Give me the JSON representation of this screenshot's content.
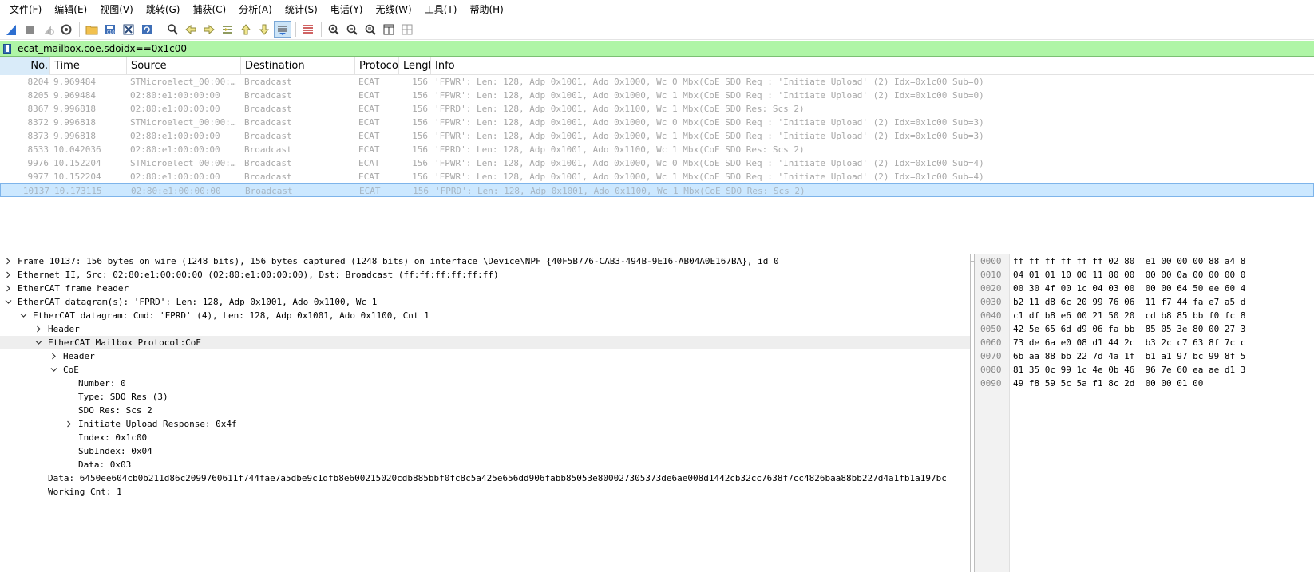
{
  "menu": [
    "文件(F)",
    "编辑(E)",
    "视图(V)",
    "跳转(G)",
    "捕获(C)",
    "分析(A)",
    "统计(S)",
    "电话(Y)",
    "无线(W)",
    "工具(T)",
    "帮助(H)"
  ],
  "toolbar": {
    "icons": [
      "shark-fin-start-icon",
      "stop-square-icon",
      "restart-icon",
      "capture-options-gear-icon",
      "open-folder-icon",
      "save-file-icon",
      "close-file-icon",
      "reload-icon",
      "find-magnifier-icon",
      "go-back-arrow-icon",
      "go-forward-arrow-icon",
      "go-to-packet-icon",
      "go-first-packet-icon",
      "go-last-packet-icon",
      "auto-scroll-icon",
      "colorize-lines-icon",
      "zoom-in-icon",
      "zoom-out-icon",
      "zoom-reset-icon",
      "resize-columns-icon",
      "layout-grid-icon"
    ]
  },
  "filter": {
    "value": "ecat_mailbox.coe.sdoidx==0x1c00"
  },
  "packet_list": {
    "columns": [
      "No.",
      "Time",
      "Source",
      "Destination",
      "Protoco",
      "Lengt",
      "Info"
    ],
    "rows": [
      {
        "no": "8204",
        "time": "9.969484",
        "src": "STMicroelect_00:00:…",
        "dst": "Broadcast",
        "proto": "ECAT",
        "len": "156",
        "info": "'FPWR': Len: 128, Adp 0x1001, Ado 0x1000, Wc 0  Mbx(CoE SDO Req : 'Initiate Upload' (2) Idx=0x1c00 Sub=0)"
      },
      {
        "no": "8205",
        "time": "9.969484",
        "src": "02:80:e1:00:00:00",
        "dst": "Broadcast",
        "proto": "ECAT",
        "len": "156",
        "info": "'FPWR': Len: 128, Adp 0x1001, Ado 0x1000, Wc 1  Mbx(CoE SDO Req : 'Initiate Upload' (2) Idx=0x1c00 Sub=0)"
      },
      {
        "no": "8367",
        "time": "9.996818",
        "src": "02:80:e1:00:00:00",
        "dst": "Broadcast",
        "proto": "ECAT",
        "len": "156",
        "info": "'FPRD': Len: 128, Adp 0x1001, Ado 0x1100, Wc 1  Mbx(CoE SDO Res: Scs 2)"
      },
      {
        "no": "8372",
        "time": "9.996818",
        "src": "STMicroelect_00:00:…",
        "dst": "Broadcast",
        "proto": "ECAT",
        "len": "156",
        "info": "'FPWR': Len: 128, Adp 0x1001, Ado 0x1000, Wc 0  Mbx(CoE SDO Req : 'Initiate Upload' (2) Idx=0x1c00 Sub=3)"
      },
      {
        "no": "8373",
        "time": "9.996818",
        "src": "02:80:e1:00:00:00",
        "dst": "Broadcast",
        "proto": "ECAT",
        "len": "156",
        "info": "'FPWR': Len: 128, Adp 0x1001, Ado 0x1000, Wc 1  Mbx(CoE SDO Req : 'Initiate Upload' (2) Idx=0x1c00 Sub=3)"
      },
      {
        "no": "8533",
        "time": "10.042036",
        "src": "02:80:e1:00:00:00",
        "dst": "Broadcast",
        "proto": "ECAT",
        "len": "156",
        "info": "'FPRD': Len: 128, Adp 0x1001, Ado 0x1100, Wc 1  Mbx(CoE SDO Res: Scs 2)"
      },
      {
        "no": "9976",
        "time": "10.152204",
        "src": "STMicroelect_00:00:…",
        "dst": "Broadcast",
        "proto": "ECAT",
        "len": "156",
        "info": "'FPWR': Len: 128, Adp 0x1001, Ado 0x1000, Wc 0  Mbx(CoE SDO Req : 'Initiate Upload' (2) Idx=0x1c00 Sub=4)"
      },
      {
        "no": "9977",
        "time": "10.152204",
        "src": "02:80:e1:00:00:00",
        "dst": "Broadcast",
        "proto": "ECAT",
        "len": "156",
        "info": "'FPWR': Len: 128, Adp 0x1001, Ado 0x1000, Wc 1  Mbx(CoE SDO Req : 'Initiate Upload' (2) Idx=0x1c00 Sub=4)"
      },
      {
        "no": "10137",
        "time": "10.173115",
        "src": "02:80:e1:00:00:00",
        "dst": "Broadcast",
        "proto": "ECAT",
        "len": "156",
        "info": "'FPRD': Len: 128, Adp 0x1001, Ado 0x1100, Wc 1  Mbx(CoE SDO Res: Scs 2)"
      }
    ]
  },
  "details": [
    {
      "text": "Frame 10137: 156 bytes on wire (1248 bits), 156 bytes captured (1248 bits) on interface \\Device\\NPF_{40F5B776-CAB3-494B-9E16-AB04A0E167BA}, id 0",
      "level": 0,
      "arrow": "right"
    },
    {
      "text": "Ethernet II, Src: 02:80:e1:00:00:00 (02:80:e1:00:00:00), Dst: Broadcast (ff:ff:ff:ff:ff:ff)",
      "level": 0,
      "arrow": "right"
    },
    {
      "text": "EtherCAT frame header",
      "level": 0,
      "arrow": "right"
    },
    {
      "text": "EtherCAT datagram(s): 'FPRD': Len: 128, Adp 0x1001, Ado 0x1100, Wc 1",
      "level": 0,
      "arrow": "down"
    },
    {
      "text": "EtherCAT datagram: Cmd: 'FPRD' (4), Len: 128, Adp 0x1001, Ado 0x1100, Cnt 1",
      "level": 1,
      "arrow": "down"
    },
    {
      "text": "Header",
      "level": 2,
      "arrow": "right"
    },
    {
      "text": "EtherCAT Mailbox Protocol:CoE",
      "level": 2,
      "arrow": "down",
      "highlight": true
    },
    {
      "text": "Header",
      "level": 3,
      "arrow": "right"
    },
    {
      "text": "CoE",
      "level": 3,
      "arrow": "down"
    },
    {
      "text": "Number: 0",
      "level": 4,
      "arrow": "none"
    },
    {
      "text": "Type: SDO Res (3)",
      "level": 4,
      "arrow": "none"
    },
    {
      "text": "SDO Res: Scs 2",
      "level": 4,
      "arrow": "none"
    },
    {
      "text": "Initiate Upload Response: 0x4f",
      "level": 4,
      "arrow": "right"
    },
    {
      "text": "Index: 0x1c00",
      "level": 4,
      "arrow": "none"
    },
    {
      "text": "SubIndex: 0x04",
      "level": 4,
      "arrow": "none"
    },
    {
      "text": "Data: 0x03",
      "level": 4,
      "arrow": "none"
    },
    {
      "text": "Data: 6450ee604cb0b211d86c2099760611f744fae7a5dbe9c1dfb8e600215020cdb885bbf0fc8c5a425e656dd906fabb85053e800027305373de6ae008d1442cb32cc7638f7cc4826baa88bb227d4a1fb1a197bc",
      "level": 2,
      "arrow": "none"
    },
    {
      "text": "Working Cnt: 1",
      "level": 2,
      "arrow": "none"
    }
  ],
  "hex": {
    "offsets": [
      "0000",
      "0010",
      "0020",
      "0030",
      "0040",
      "0050",
      "0060",
      "0070",
      "0080",
      "0090"
    ],
    "bytes": [
      "ff ff ff ff ff ff 02 80  e1 00 00 00 88 a4 8",
      "04 01 01 10 00 11 80 00  00 00 0a 00 00 00 0",
      "00 30 4f 00 1c 04 03 00  00 00 64 50 ee 60 4",
      "b2 11 d8 6c 20 99 76 06  11 f7 44 fa e7 a5 d",
      "c1 df b8 e6 00 21 50 20  cd b8 85 bb f0 fc 8",
      "42 5e 65 6d d9 06 fa bb  85 05 3e 80 00 27 3",
      "73 de 6a e0 08 d1 44 2c  b3 2c c7 63 8f 7c c",
      "6b aa 88 bb 22 7d 4a 1f  b1 a1 97 bc 99 8f 5",
      "81 35 0c 99 1c 4e 0b 46  96 7e 60 ea ae d1 3",
      "49 f8 59 5c 5a f1 8c 2d  00 00 01 00"
    ]
  }
}
